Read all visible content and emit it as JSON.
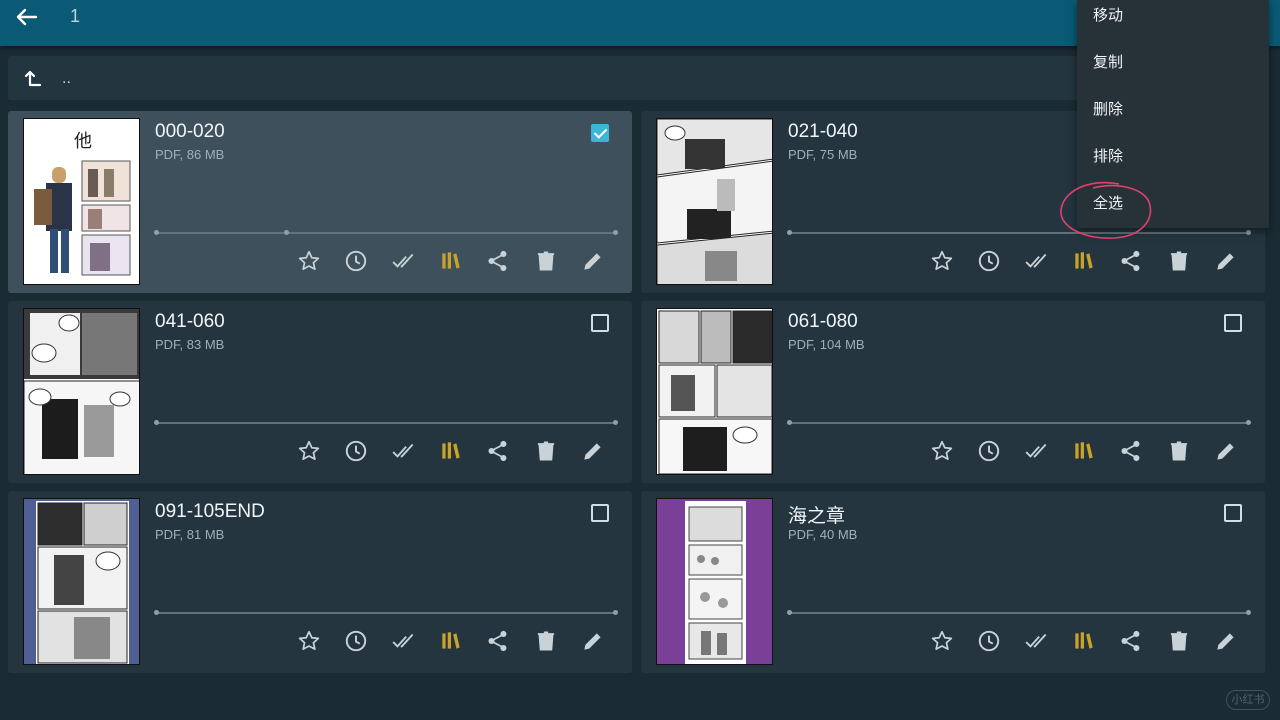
{
  "header": {
    "selected_count": "1"
  },
  "path": {
    "parent": ".."
  },
  "context_menu": {
    "items": [
      {
        "label": "移动"
      },
      {
        "label": "复制"
      },
      {
        "label": "删除"
      },
      {
        "label": "排除"
      },
      {
        "label": "全选"
      }
    ]
  },
  "files": [
    {
      "title": "000-020",
      "meta": "PDF, 86 MB",
      "checked": true,
      "cover_bg": "#ffffff"
    },
    {
      "title": "021-040",
      "meta": "PDF, 75 MB",
      "checked": false,
      "cover_bg": "#ffffff"
    },
    {
      "title": "041-060",
      "meta": "PDF, 83 MB",
      "checked": false,
      "cover_bg": "#ffffff"
    },
    {
      "title": "061-080",
      "meta": "PDF, 104 MB",
      "checked": false,
      "cover_bg": "#ffffff"
    },
    {
      "title": "091-105END",
      "meta": "PDF, 81 MB",
      "checked": false,
      "cover_bg": "#4e5f93"
    },
    {
      "title": "海之章",
      "meta": "PDF, 40 MB",
      "checked": false,
      "cover_bg": "#7a3f96"
    }
  ],
  "cover_text": {
    "cover_title_glyph": "他"
  },
  "watermark": "小红书",
  "colors": {
    "appbar": "#0a5a75",
    "background": "#1b2b33",
    "card": "#24353f",
    "card_selected": "#3e505b",
    "checkbox_checked": "#3cb6d8",
    "library_icon": "#c9a227",
    "annotation_circle": "#e0406e"
  },
  "action_icons": [
    "star-icon",
    "clock-icon",
    "double-check-icon",
    "library-icon",
    "share-icon",
    "delete-icon",
    "edit-icon"
  ]
}
